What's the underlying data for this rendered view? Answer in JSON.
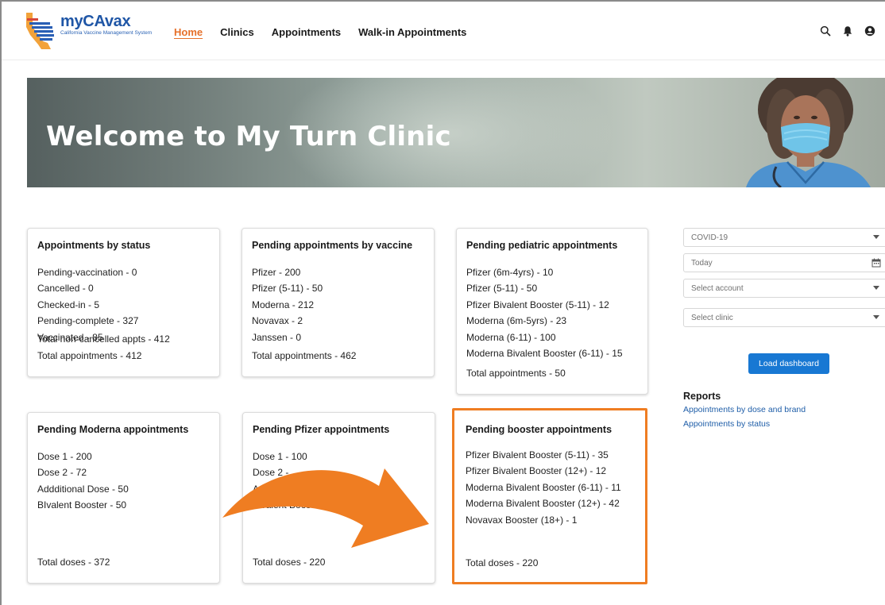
{
  "brand": {
    "name": "myCAvax",
    "subtitle": "California Vaccine Management System"
  },
  "nav": {
    "items": [
      {
        "label": "Home",
        "active": true
      },
      {
        "label": "Clinics",
        "active": false
      },
      {
        "label": "Appointments",
        "active": false
      },
      {
        "label": "Walk-in Appointments",
        "active": false
      }
    ]
  },
  "header_icons": [
    "search-icon",
    "bell-icon",
    "user-icon"
  ],
  "banner": {
    "title": "Welcome to My Turn Clinic"
  },
  "cards": [
    {
      "title": "Appointments by status",
      "lines": [
        "Pending-vaccination - 0",
        "Cancelled - 0",
        "Checked-in - 5",
        "Pending-complete - 327",
        "Vaccinated - 85"
      ],
      "footer": [
        "Total non-cancelled appts - 412",
        "Total appointments - 412"
      ]
    },
    {
      "title": "Pending appointments by vaccine",
      "lines": [
        "Pfizer - 200",
        "Pfizer (5-11) - 50",
        "Moderna - 212",
        "Novavax - 2",
        "Janssen - 0"
      ],
      "footer": [
        "Total appointments - 462"
      ]
    },
    {
      "title": "Pending pediatric appointments",
      "lines": [
        "Pfizer (6m-4yrs) - 10",
        "Pfizer (5-11) - 50",
        "Pfizer Bivalent Booster (5-11) - 12",
        "Moderna (6m-5yrs) - 23",
        "Moderna (6-11) - 100",
        "Moderna Bivalent Booster (6-11) - 15"
      ],
      "footer": [
        "Total appointments - 50"
      ]
    },
    {
      "title": "Pending Moderna appointments",
      "lines": [
        "Dose 1 - 200",
        "Dose 2 - 72",
        "Addditional Dose - 50",
        "BIvalent Booster - 50"
      ],
      "footer": [
        "Total doses - 372"
      ]
    },
    {
      "title": "Pending Pfizer appointments",
      "lines": [
        "Dose 1 - 100",
        "Dose 2 - ",
        "A",
        "Bivalent Booster"
      ],
      "footer": [
        "Total doses - 220"
      ]
    },
    {
      "title": "Pending booster appointments",
      "lines": [
        "Pfizer Bivalent Booster (5-11) - 35",
        "Pfizer Bivalent Booster (12+) - 12",
        "Moderna Bivalent Booster (6-11) - 11",
        "Moderna Bivalent Booster (12+) - 42",
        "Novavax Booster (18+) - 1"
      ],
      "footer": [
        "Total doses - 220"
      ]
    }
  ],
  "filters": {
    "vaccine": "COVID-19",
    "date": "Today",
    "account_placeholder": "Select account",
    "clinic_placeholder": "Select clinic"
  },
  "load_button": "Load dashboard",
  "reports": {
    "title": "Reports",
    "links": [
      "Appointments by dose and brand",
      "Appointments by status"
    ]
  },
  "colors": {
    "brand_blue": "#1f56a6",
    "nav_active": "#e6702a",
    "highlight_orange": "#ef7d22",
    "button_blue": "#1878d3",
    "link_blue": "#1f5ea8"
  }
}
